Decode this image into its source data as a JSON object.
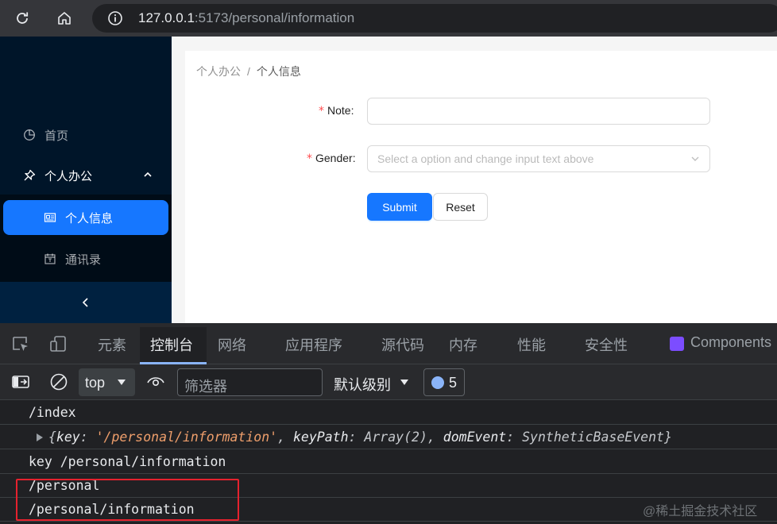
{
  "browser": {
    "url_host": "127.0.0.1",
    "url_path": ":5173/personal/information",
    "reload_icon": "reload-icon",
    "home_icon": "home-icon",
    "info_icon": "info-icon"
  },
  "sidebar": {
    "items": [
      {
        "label": "首页",
        "icon": "pie-chart-icon"
      },
      {
        "label": "个人办公",
        "icon": "pushpin-icon",
        "expanded": true
      },
      {
        "label": "个人信息",
        "icon": "id-card-icon",
        "selected": true
      },
      {
        "label": "通讯录",
        "icon": "calendar-icon"
      }
    ],
    "collapse_icon": "chevron-left-icon"
  },
  "breadcrumb": {
    "parent": "个人办公",
    "separator": "/",
    "current": "个人信息"
  },
  "form": {
    "note_label": "Note",
    "note_value": "",
    "gender_label": "Gender",
    "gender_placeholder": "Select a option and change input text above",
    "required_mark": "*",
    "colon": ":",
    "submit_label": "Submit",
    "reset_label": "Reset"
  },
  "devtools": {
    "tabs": [
      "元素",
      "控制台",
      "网络",
      "应用程序",
      "源代码",
      "内存",
      "性能",
      "安全性",
      "Components"
    ],
    "active_tab": "控制台",
    "toolbar": {
      "context": "top",
      "filter_placeholder": "筛选器",
      "level": "默认级别",
      "issues_count": "5"
    },
    "console": {
      "line1": "/index",
      "line2_obj": {
        "open": "{",
        "k1": "key",
        "v1": "'/personal/information'",
        "k2": "keyPath",
        "v2": "Array(2)",
        "k3": "domEvent",
        "v3": "SyntheticBaseEvent",
        "close": "}"
      },
      "line3": "key /personal/information",
      "line4": "/personal",
      "line5": "/personal/information"
    }
  },
  "watermark": "@稀土掘金技术社区",
  "colors": {
    "accent": "#1677ff",
    "sidebar_bg": "#001529",
    "required": "#ff4d4f",
    "highlight_box": "#e5222e"
  }
}
